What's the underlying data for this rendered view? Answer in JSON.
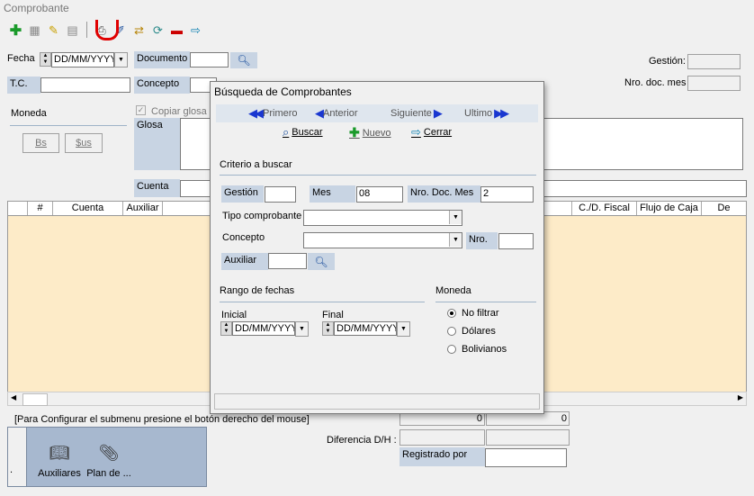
{
  "window": {
    "title": "Comprobante"
  },
  "toolbar": {
    "icons": [
      "add-icon",
      "document-icon",
      "edit-pencil-icon",
      "grid-icon",
      "print-icon",
      "search-edit-icon",
      "transfer-icon",
      "refresh-icon",
      "delete-icon",
      "exit-icon"
    ]
  },
  "header": {
    "fecha_label": "Fecha",
    "fecha_value": "DD/MM/YYYY",
    "documento_label": "Documento",
    "documento_value": "",
    "gestion_label": "Gestión:",
    "nro_doc_mes_label": "Nro. doc. mes",
    "tc_label": "T.C.",
    "concepto_label": "Concepto",
    "moneda_label": "Moneda",
    "bs_label": "Bs",
    "sus_label": "$us",
    "copiar_glosa_label": "Copiar glosa e",
    "glosa_label": "Glosa",
    "cuenta_label": "Cuenta"
  },
  "grid": {
    "columns": [
      "",
      "#",
      "Cuenta",
      "Auxiliar",
      "C./D. Fiscal",
      "Flujo de Caja",
      "De"
    ]
  },
  "footer": {
    "hint": "[Para Configurar el submenu presione  el botón derecho del mouse]",
    "total1": "0",
    "total2": "0",
    "diferencia_label": "Diferencia D/H :",
    "registrado_label": "Registrado por",
    "panel_dot": ".",
    "panel_items": [
      {
        "label": "Auxiliares",
        "icon": "book-icon"
      },
      {
        "label": "Plan de ...",
        "icon": "binder-icon"
      }
    ]
  },
  "dialog": {
    "title": "Búsqueda de Comprobantes",
    "nav": {
      "primero": "Primero",
      "anterior": "Anterior",
      "siguiente": "Siguiente",
      "ultimo": "Ultimo"
    },
    "actions": {
      "buscar": "Buscar",
      "nuevo": "Nuevo",
      "cerrar": "Cerrar"
    },
    "criterio_label": "Criterio a buscar",
    "gestion_label": "Gestión",
    "gestion_value": "",
    "mes_label": "Mes",
    "mes_value": "08",
    "nro_doc_mes_label": "Nro. Doc. Mes",
    "nro_doc_mes_value": "2",
    "tipo_label": "Tipo comprobante",
    "tipo_value": "",
    "concepto_label": "Concepto",
    "concepto_value": "",
    "nro_label": "Nro.",
    "nro_value": "",
    "auxiliar_label": "Auxiliar",
    "auxiliar_value": "",
    "rango_label": "Rango de fechas",
    "inicial_label": "Inicial",
    "inicial_value": "DD/MM/YYYY",
    "final_label": "Final",
    "final_value": "DD/MM/YYYY",
    "moneda_label": "Moneda",
    "moneda_options": [
      {
        "label": "No filtrar",
        "selected": true
      },
      {
        "label": "Dólares",
        "selected": false
      },
      {
        "label": "Bolivianos",
        "selected": false
      }
    ],
    "status": ""
  },
  "colors": {
    "highlight_ring": "#e00000",
    "grid_body": "#fdebc8",
    "label_blue": "#c8d4e3"
  }
}
